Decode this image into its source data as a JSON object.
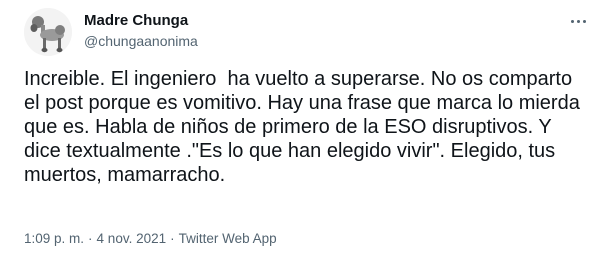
{
  "author": {
    "display_name": "Madre Chunga",
    "handle": "@chungaanonima"
  },
  "more_icon": "more-horizontal-icon",
  "tweet": {
    "text": "Increible. El ingeniero  ha vuelto a superarse. No os comparto el post porque es vomitivo. Hay una frase que marca lo mierda que es. Habla de niños de primero de la ESO disruptivos. Y dice textualmente .\"Es lo que han elegido vivir\". Elegido, tus muertos, mamarracho."
  },
  "meta": {
    "time": "1:09 p. m.",
    "separator": "·",
    "date": "4 nov. 2021",
    "source": "Twitter Web App"
  }
}
